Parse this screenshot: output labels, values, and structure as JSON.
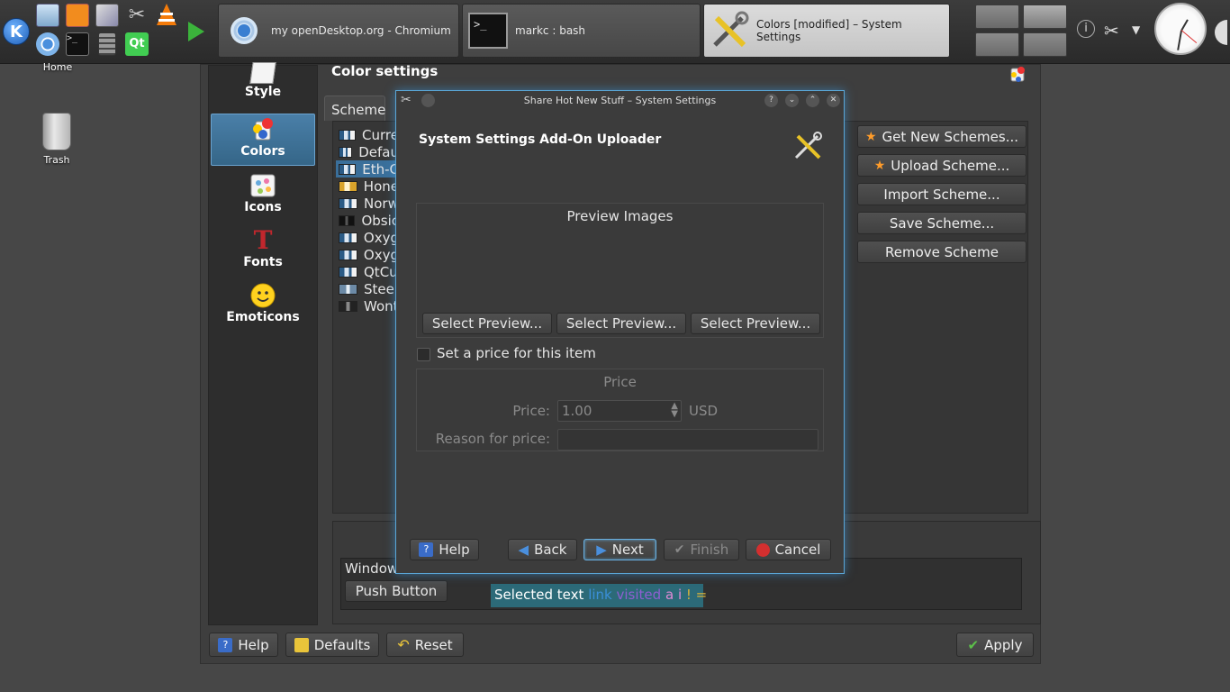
{
  "taskbar": {
    "tasks": [
      {
        "label": "my openDesktop.org - Chromium",
        "icon": "chromium-icon"
      },
      {
        "label": "markc : bash",
        "icon": "terminal-icon"
      },
      {
        "label": "Colors [modified] – System Settings",
        "icon": "tools-icon"
      }
    ]
  },
  "desktop": {
    "home_label": "Home",
    "trash_label": "Trash"
  },
  "settings": {
    "page_title": "Color settings",
    "categories": [
      {
        "label": "Style"
      },
      {
        "label": "Colors"
      },
      {
        "label": "Icons"
      },
      {
        "label": "Fonts"
      },
      {
        "label": "Emoticons"
      }
    ],
    "tab_scheme": "Scheme",
    "schemes": [
      "Curre",
      "Defau",
      "Eth-C",
      "Hone",
      "Norw",
      "Obsic",
      "Oxyg",
      "Oxyg",
      "QtCu",
      "Steel",
      "Wont"
    ],
    "side_buttons": {
      "get_new": "Get New Schemes...",
      "upload": "Upload Scheme...",
      "import": "Import Scheme...",
      "save": "Save Scheme...",
      "remove": "Remove Scheme"
    },
    "preview": {
      "window_label": "Window",
      "push_button": "Push Button",
      "selected_text": "Selected text",
      "link": "link",
      "visited": "visited",
      "a": "a",
      "i": "i",
      "eq": "! ="
    },
    "bottom": {
      "help": "Help",
      "defaults": "Defaults",
      "reset": "Reset",
      "apply": "Apply"
    }
  },
  "dialog": {
    "title": "Share Hot New Stuff – System Settings",
    "heading": "System Settings Add-On Uploader",
    "preview_group_title": "Preview Images",
    "select_preview": "Select Preview...",
    "price_checkbox": "Set a price for this item",
    "price_group_title": "Price",
    "price_label": "Price:",
    "price_value": "1.00",
    "currency": "USD",
    "reason_label": "Reason for price:",
    "buttons": {
      "help": "Help",
      "back": "Back",
      "next": "Next",
      "finish": "Finish",
      "cancel": "Cancel"
    }
  },
  "colors": {
    "accent": "#5aa6d6",
    "selection": "#3a6f9a",
    "background": "#474747"
  }
}
